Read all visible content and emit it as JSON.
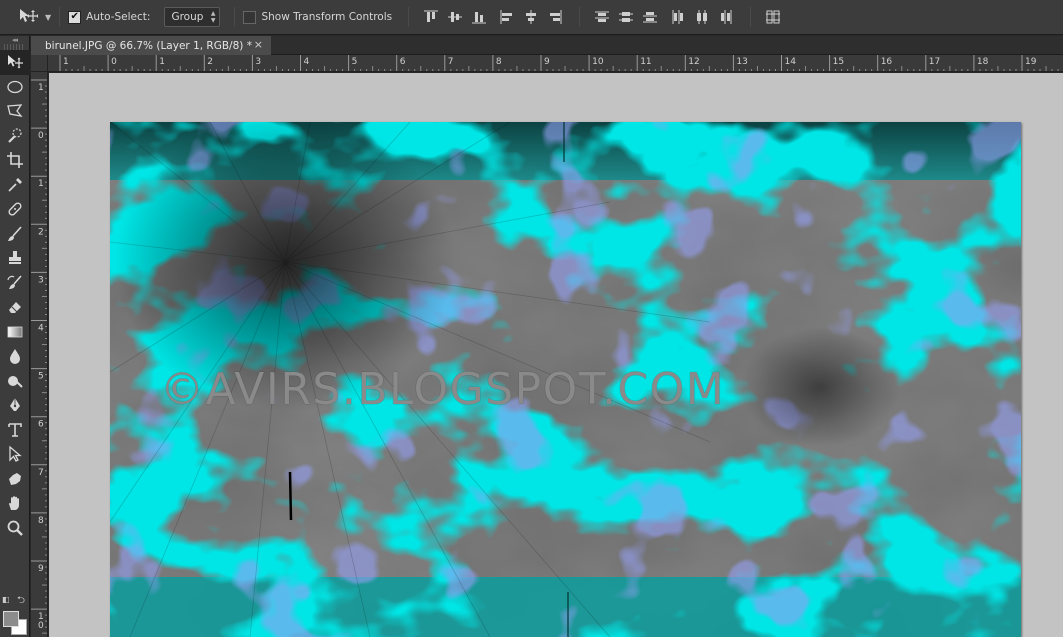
{
  "options_bar": {
    "auto_select_label": "Auto-Select:",
    "auto_select_checked": true,
    "group_dropdown_value": "Group",
    "show_transform_label": "Show Transform Controls",
    "show_transform_checked": false
  },
  "document": {
    "tab_title": "birunel.JPG @ 66.7% (Layer 1, RGB/8) *",
    "close_glyph": "×",
    "zoom": "66.7%",
    "watermark_text": "©AVIRS.BLOGSPOT.COM"
  },
  "rulers": {
    "horizontal_labels": [
      "1",
      "0",
      "1",
      "2",
      "3",
      "4",
      "5",
      "6",
      "7",
      "8",
      "9",
      "10",
      "11",
      "12",
      "13",
      "14",
      "15",
      "16",
      "17",
      "18",
      "19"
    ],
    "vertical_labels": [
      "1",
      "0",
      "1",
      "2",
      "3",
      "4",
      "5",
      "6",
      "7",
      "8",
      "9",
      "1\n0"
    ]
  },
  "tools": [
    "move-tool",
    "marquee-tool",
    "lasso-tool",
    "quick-selection-tool",
    "crop-tool",
    "eyedropper-tool",
    "healing-brush-tool",
    "brush-tool",
    "clone-stamp-tool",
    "history-brush-tool",
    "eraser-tool",
    "gradient-tool",
    "blur-tool",
    "dodge-tool",
    "pen-tool",
    "type-tool",
    "path-selection-tool",
    "custom-shape-tool",
    "hand-tool",
    "zoom-tool"
  ],
  "colors": {
    "foreground": "#8c8c8c",
    "background": "#ffffff",
    "canvas_bg": "#c3c3c3",
    "teal": "#00c8c8"
  }
}
